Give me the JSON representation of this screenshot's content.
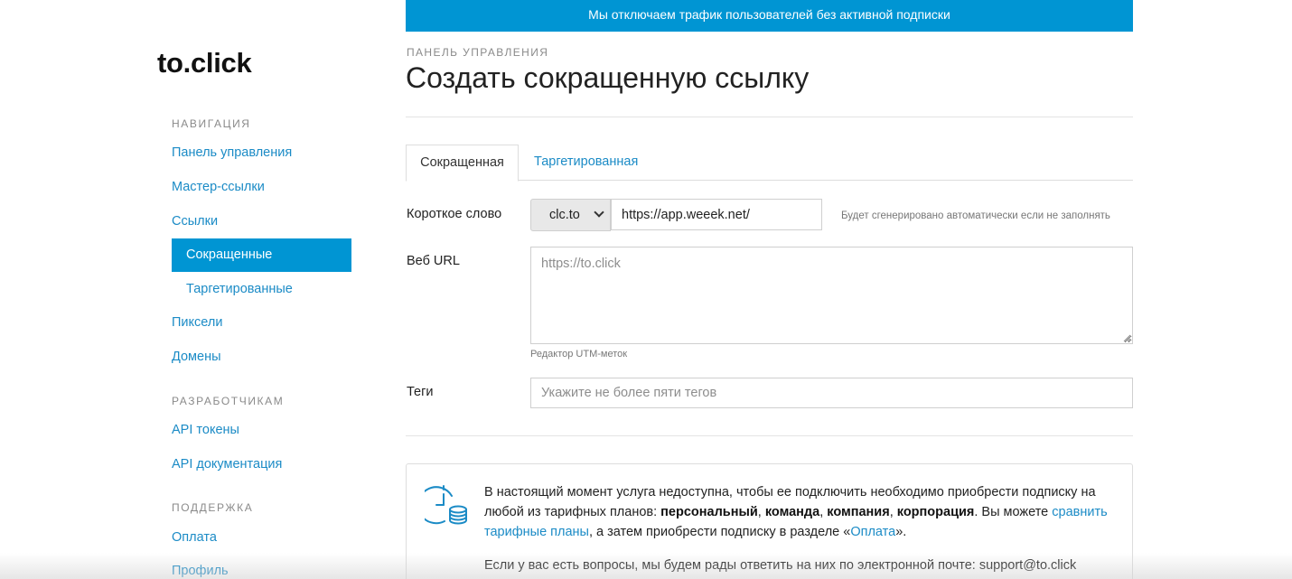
{
  "brand": {
    "logo": "to.click"
  },
  "banner": {
    "text": "Мы отключаем трафик пользователей без активной подписки"
  },
  "sidebar": {
    "nav_heading": "НАВИГАЦИЯ",
    "dev_heading": "РАЗРАБОТЧИКАМ",
    "support_heading": "ПОДДЕРЖКА",
    "items": {
      "dashboard": "Панель управления",
      "master_links": "Мастер-ссылки",
      "links": "Ссылки",
      "shortened": "Сокращенные",
      "targeted": "Таргетированные",
      "pixels": "Пиксели",
      "domains": "Домены",
      "api_tokens": "API токены",
      "api_docs": "API документация",
      "payment": "Оплата",
      "profile": "Профиль"
    }
  },
  "main": {
    "breadcrumb": "ПАНЕЛЬ УПРАВЛЕНИЯ",
    "title": "Создать сокращенную ссылку",
    "tabs": [
      {
        "label": "Сокращенная",
        "active": true
      },
      {
        "label": "Таргетированная",
        "active": false
      }
    ],
    "form": {
      "short_word_label": "Короткое слово",
      "domain_selected": "clc.to",
      "short_word_value": "https://app.weeek.net/",
      "short_word_hint": "Будет сгенерировано автоматически если не заполнять",
      "web_url_label": "Веб URL",
      "web_url_placeholder": "https://to.click",
      "utm_hint": "Редактор UTM-меток",
      "tags_label": "Теги",
      "tags_placeholder": "Укажите не более пяти тегов"
    },
    "notice": {
      "p1_a": "В настоящий момент услуга недоступна, чтобы ее подключить необходимо приобрести подписку на любой из тарифных планов: ",
      "plan_personal": "персональный",
      "sep1": ", ",
      "plan_team": "команда",
      "sep2": ", ",
      "plan_company": "компания",
      "sep3": ", ",
      "plan_corp": "корпорация",
      "p1_b": ". Вы можете ",
      "compare_link": "сравнить тарифные планы",
      "p1_c": ", а затем приобрести подписку в разделе «",
      "payment_link": "Оплата",
      "p1_d": "».",
      "p2": "Если у вас есть вопросы, мы будем рады ответить на них по электронной почте: support@to.click"
    }
  },
  "colors": {
    "accent": "#0095d3",
    "link": "#1b8bc6"
  },
  "icons": {
    "notice": "clock-coins-icon",
    "select": "chevron-down-icon"
  }
}
